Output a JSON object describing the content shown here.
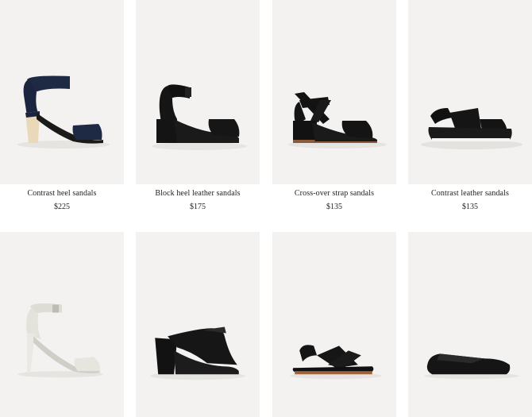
{
  "products": [
    {
      "name": "Contrast heel sandals",
      "price": "$225",
      "icon": "navy-ankle-strap-block-heel-sandal"
    },
    {
      "name": "Block heel leather sandals",
      "price": "$175",
      "icon": "black-block-heel-sandal"
    },
    {
      "name": "Cross-over strap sandals",
      "price": "$135",
      "icon": "black-cross-strap-sandal"
    },
    {
      "name": "Contrast leather sandals",
      "price": "$135",
      "icon": "black-flatform-sandal"
    },
    {
      "name": "",
      "price": "",
      "icon": "white-stiletto-sandal"
    },
    {
      "name": "",
      "price": "",
      "icon": "black-block-heel-mule"
    },
    {
      "name": "",
      "price": "",
      "icon": "black-flat-slingback-sandal"
    },
    {
      "name": "",
      "price": "",
      "icon": "black-slipper-flat"
    }
  ],
  "colors": {
    "tile_background": "#f3f2f1",
    "text": "#222222"
  }
}
